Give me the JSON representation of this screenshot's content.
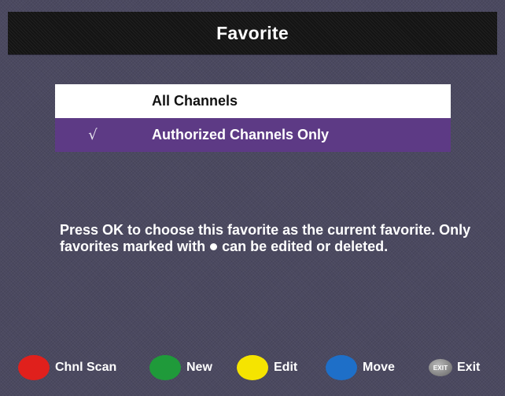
{
  "header": {
    "title": "Favorite"
  },
  "favorites": {
    "items": [
      {
        "label": "All Channels",
        "check": "",
        "selected": false
      },
      {
        "label": "Authorized Channels Only",
        "check": "√",
        "selected": true
      }
    ]
  },
  "help": {
    "text_before_dot": "Press OK to choose this favorite as the current favorite. Only favorites marked with ",
    "text_after_dot": " can be edited or deleted."
  },
  "footer": {
    "keys": [
      {
        "icon": "red-button-icon",
        "color": "#e0201c",
        "label": "Chnl Scan"
      },
      {
        "icon": "green-button-icon",
        "color": "#1f9a3a",
        "label": "New"
      },
      {
        "icon": "yellow-button-icon",
        "color": "#f5e400",
        "label": "Edit"
      },
      {
        "icon": "blue-button-icon",
        "color": "#1e6fc8",
        "label": "Move"
      }
    ],
    "exit": {
      "icon_text": "EXIT",
      "label": "Exit"
    }
  }
}
